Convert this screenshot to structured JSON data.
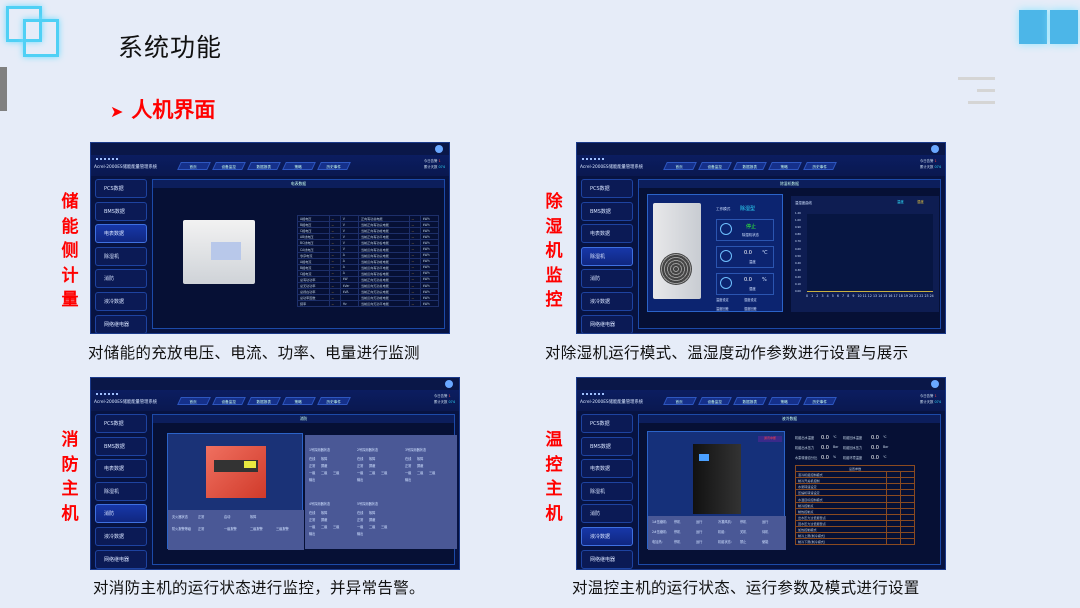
{
  "slide": {
    "title": "系统功能",
    "subtitle": "人机界面",
    "bullet_icon": "arrow-right-icon",
    "accent": "#ff0000",
    "background": "#e6ecf8"
  },
  "app": {
    "system_title": "Acrel-2000ES储能能量管理系统",
    "tabs": [
      "首页",
      "设备监控",
      "数据报表",
      "策略",
      "历史事件"
    ],
    "sidebar": [
      "PCS数据",
      "BMS数据",
      "电表数据",
      "除湿机",
      "消防",
      "液冷数据",
      "网络继电器"
    ],
    "status": {
      "alarm_label": "今日告警",
      "alarm_value": "1",
      "run_label": "累计天数",
      "run_value": "074"
    },
    "user": "admin"
  },
  "panels": [
    {
      "label": "储能侧计量",
      "caption": "对储能的充放电压、电流、功率、电量进行监测",
      "active": 2,
      "content_title": "电表数据",
      "rows": [
        [
          "A相电压",
          "--",
          "V",
          "正向有功总电能",
          "--",
          "kWh"
        ],
        [
          "B相电压",
          "--",
          "V",
          "当前正向有功尖电能",
          "--",
          "kWh"
        ],
        [
          "C相电压",
          "--",
          "V",
          "当前正向有功峰电能",
          "--",
          "kWh"
        ],
        [
          "AB线电压",
          "--",
          "V",
          "当前正向有功平电能",
          "--",
          "kWh"
        ],
        [
          "BC线电压",
          "--",
          "V",
          "当前正向有功谷电能",
          "--",
          "kWh"
        ],
        [
          "CA线电压",
          "--",
          "V",
          "当前反向有功总电能",
          "--",
          "kWh"
        ],
        [
          "零序电流",
          "--",
          "A",
          "当前反向有功尖电能",
          "--",
          "kWh"
        ],
        [
          "A相电流",
          "--",
          "A",
          "当前反向有功峰电能",
          "--",
          "kWh"
        ],
        [
          "B相电流",
          "--",
          "A",
          "当前反向有功平电能",
          "--",
          "kWh"
        ],
        [
          "C相电流",
          "--",
          "A",
          "当前反向有功谷电能",
          "--",
          "kWh"
        ],
        [
          "总有功功率",
          "--",
          "kW",
          "当前正向无功总电能",
          "--",
          "kWh"
        ],
        [
          "总无功功率",
          "--",
          "kVar",
          "当前反向无功总电能",
          "--",
          "kWh"
        ],
        [
          "总视在功率",
          "--",
          "kVA",
          "当前正向无功尖电能",
          "--",
          "kWh"
        ],
        [
          "总功率因数",
          "--",
          "",
          "当前反向无功峰电能",
          "--",
          "kWh"
        ],
        [
          "频率",
          "--",
          "Hz",
          "当前反向无功平电能",
          "--",
          "kWh"
        ]
      ]
    },
    {
      "label": "除湿机监控",
      "caption": "对除湿机运行模式、温湿度动作参数进行设置与展示",
      "active": 3,
      "content_title": "除湿机数据",
      "mode_label": "工作模式",
      "mode_value": "除湿型",
      "run_value": "停止",
      "run_label": "除湿机状态",
      "temp_value": "0.0",
      "temp_unit": "℃",
      "temp_label": "温度",
      "hum_value": "0.0",
      "hum_unit": "%",
      "hum_label": "湿度",
      "settings": [
        "温度设定",
        "湿度设定",
        "温度回差",
        "湿度回差"
      ],
      "chart_title": "温湿度曲线",
      "legend": [
        "温度",
        "湿度"
      ],
      "yticks": [
        "1.20",
        "1.00",
        "0.90",
        "0.80",
        "0.70",
        "0.60",
        "0.50",
        "0.40",
        "0.30",
        "0.20",
        "0.10",
        "0.00"
      ],
      "xticks": [
        "0",
        "1",
        "2",
        "3",
        "4",
        "5",
        "6",
        "7",
        "8",
        "9",
        "10",
        "11",
        "12",
        "13",
        "14",
        "15",
        "16",
        "17",
        "18",
        "19",
        "20",
        "21",
        "22",
        "23",
        "24"
      ]
    },
    {
      "label": "消防主机",
      "caption": "对消防主机的运行状态进行监控，并异常告警。",
      "active": 4,
      "content_title": "消防",
      "host": [
        [
          "灭火器状态",
          "正常",
          "启动",
          "故障"
        ],
        [
          "防火报警等级",
          "正常",
          "一级报警",
          "二级报警",
          "三级报警"
        ]
      ],
      "detectors": [
        "1号探测器状态",
        "2号探测器状态",
        "3号探测器状态",
        "4号探测器状态",
        "5号探测器状态"
      ],
      "det_lines": [
        [
          "在线",
          "故障"
        ],
        [
          "正常",
          "屏蔽"
        ],
        [
          "一级",
          "二级",
          "三级"
        ],
        [
          "输出"
        ]
      ]
    },
    {
      "label": "温控主机",
      "caption": "对温控主机的运行状态、运行参数及模式进行设置",
      "active": 5,
      "content_title": "液冷数据",
      "badge": "通讯中断",
      "readings": [
        [
          "机组出水温度",
          "0.0",
          "℃",
          "机组回水温度",
          "0.0",
          "℃"
        ],
        [
          "机组出水压力",
          "0.0",
          "Bar",
          "机组回水压力",
          "0.0",
          "Bar"
        ],
        [
          "水泵转速百分比",
          "0.0",
          "%",
          "机组环境温度",
          "0.0",
          "℃"
        ]
      ],
      "params_title": "设置参数",
      "params": [
        "液冷机组控制模式",
        "制冷开关机控制",
        "水泵转速设定",
        "压缩机转速设定",
        "水温目标控制模式",
        "制冷控制点",
        "制热控制点",
        "出水压力过低报警点",
        "回水压力过低报警点",
        "加热控制模式",
        "制冷上限(制冷模式)",
        "制冷下限(制冷模式)"
      ],
      "status_rows": [
        [
          "1#压缩机:",
          "停机",
          "运行",
          "冷凝风机:",
          "停机",
          "运行"
        ],
        [
          "2#压缩机:",
          "停机",
          "运行",
          "机组:",
          "关机",
          "待机"
        ],
        [
          "电加热:",
          "停机",
          "运行",
          "机组状态:",
          "禁止",
          "使能"
        ]
      ]
    }
  ]
}
